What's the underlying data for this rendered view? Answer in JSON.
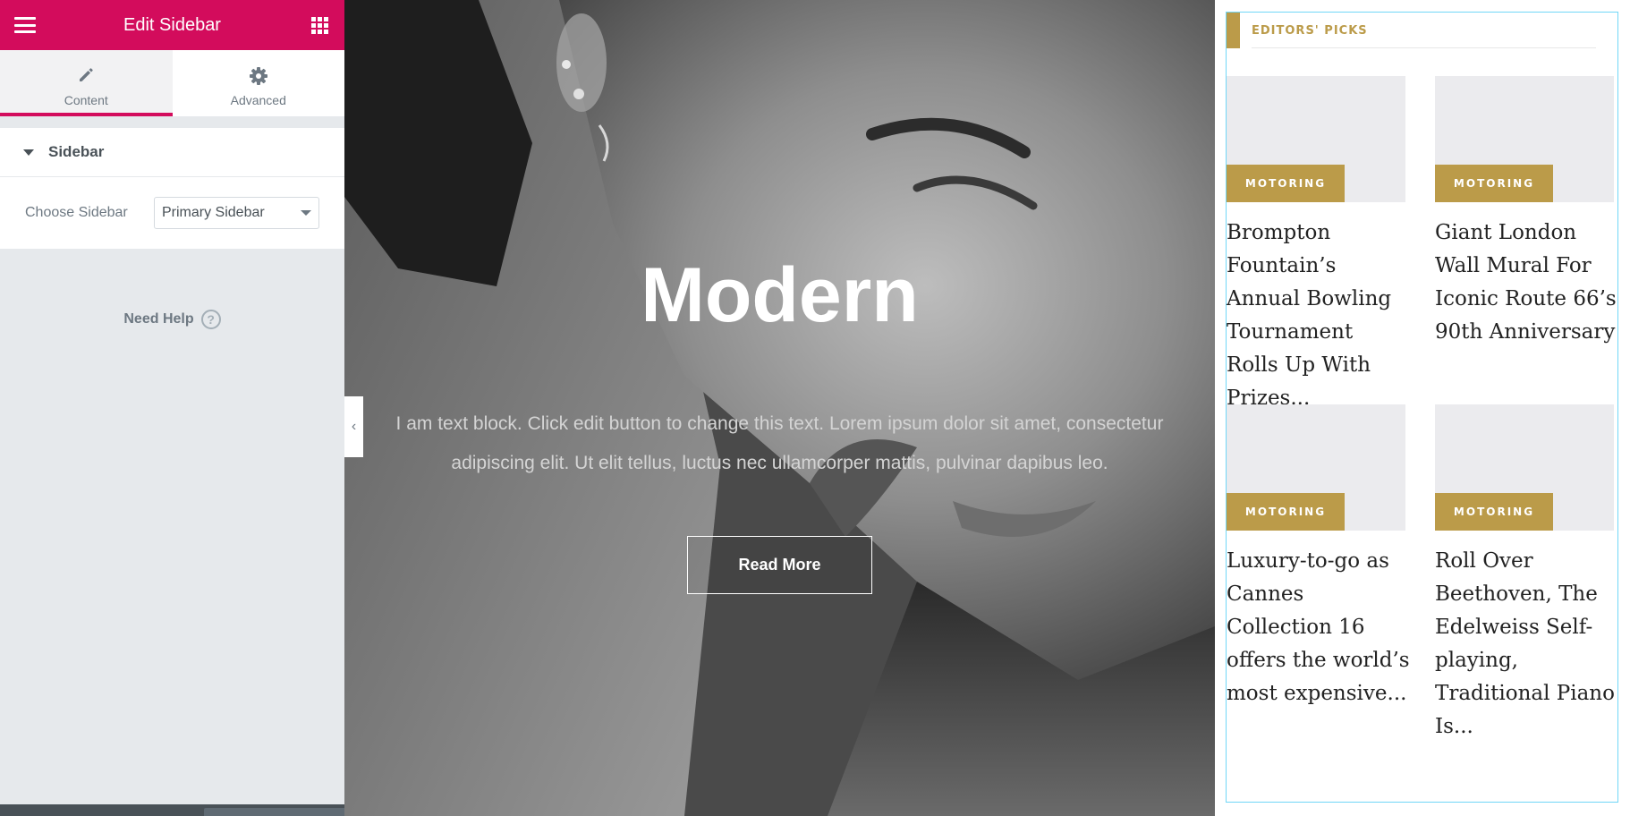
{
  "panel": {
    "title": "Edit Sidebar",
    "tabs": [
      {
        "label": "Content",
        "icon": "pencil-icon",
        "active": true
      },
      {
        "label": "Advanced",
        "icon": "gear-icon",
        "active": false
      }
    ],
    "section_title": "Sidebar",
    "control_label": "Choose Sidebar",
    "select_value": "Primary Sidebar",
    "need_help": "Need Help",
    "help_glyph": "?",
    "accent_color": "#d30c5c"
  },
  "hero": {
    "heading": "Modern",
    "text": "I am text block. Click edit button to change this text. Lorem ipsum dolor sit amet, consectetur adipiscing elit. Ut elit tellus, luctus nec ullamcorper mattis, pulvinar dapibus leo.",
    "button_label": "Read More"
  },
  "picks": {
    "title": "EDITORS' PICKS",
    "accent_color": "#bb9b49",
    "cards": [
      {
        "category": "MOTORING",
        "headline": "Brompton Fountain’s Annual Bowling Tournament Rolls Up With Prizes..."
      },
      {
        "category": "MOTORING",
        "headline": "Giant London Wall Mural For Iconic Route 66’s 90th Anniversary"
      },
      {
        "category": "MOTORING",
        "headline": "Luxury-to-go as Cannes Collection 16 offers the world’s most expensive..."
      },
      {
        "category": "MOTORING",
        "headline": "Roll Over Beethoven, The Edelweiss Self-playing, Traditional Piano Is..."
      }
    ]
  },
  "collapse_glyph": "‹"
}
